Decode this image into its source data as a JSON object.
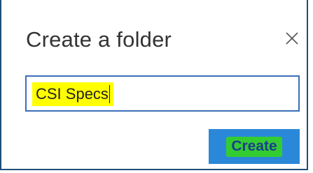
{
  "dialog": {
    "title": "Create a folder",
    "close_icon": "close-icon"
  },
  "folder_name_input": {
    "value": "CSI Specs",
    "highlight_color": "#ffff00"
  },
  "actions": {
    "create_label": "Create",
    "create_button_color": "#2b88d8",
    "create_label_highlight_color": "#33cc33"
  },
  "colors": {
    "dialog_border": "#1f4e79",
    "input_border": "#3b6fb6"
  }
}
